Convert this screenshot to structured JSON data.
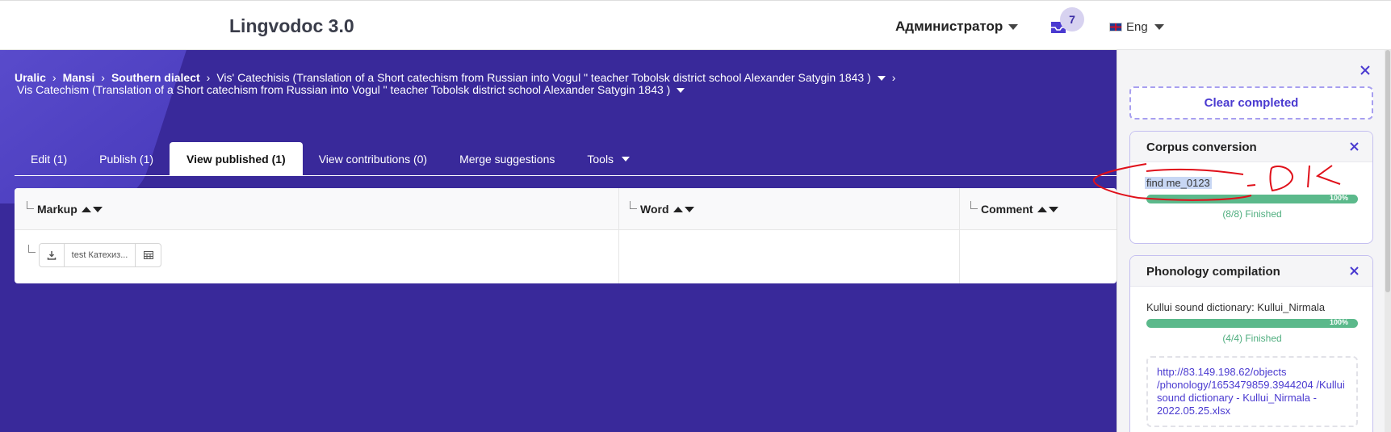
{
  "header": {
    "logo": "Lingvodoc 3.0",
    "user_menu": "Администратор",
    "notifications_count": "7",
    "language": "Eng"
  },
  "breadcrumb": {
    "items": [
      "Uralic",
      "Mansi",
      "Southern dialect",
      "Vis' Catechisis (Translation of a Short catechism from Russian into Vogul \" teacher Tobolsk district school Alexander Satygin 1843 )"
    ],
    "second_line": "Vis Catechism (Translation of a Short catechism from Russian into Vogul \" teacher Tobolsk district school Alexander Satygin 1843 )"
  },
  "tabs": [
    {
      "label": "Edit (1)"
    },
    {
      "label": "Publish (1)"
    },
    {
      "label": "View published (1)",
      "active": true
    },
    {
      "label": "View contributions (0)"
    },
    {
      "label": "Merge suggestions"
    },
    {
      "label": "Tools"
    }
  ],
  "table": {
    "columns": [
      "Markup",
      "Word",
      "Comment"
    ],
    "rows": [
      {
        "markup_file": "test Катехиз..."
      }
    ]
  },
  "panel": {
    "clear_completed": "Clear completed",
    "tasks": [
      {
        "title": "Corpus conversion",
        "name": "find me_0123",
        "progress_label": "100%",
        "progress": 1.0,
        "status": "(8/8) Finished"
      },
      {
        "title": "Phonology compilation",
        "name": "Kullui sound dictionary: Kullui_Nirmala",
        "progress_label": "100%",
        "progress": 1.0,
        "status": "(4/4) Finished",
        "link": "http://83.149.198.62/objects /phonology/1653479859.3944204 /Kullui sound dictionary - Kullui_Nirmala - 2022.05.25.xlsx"
      }
    ]
  },
  "colors": {
    "brand_purple": "#39299a",
    "accent": "#4a3ad0",
    "progress_green": "#5bb98b",
    "annotation_red": "#e0101a"
  }
}
